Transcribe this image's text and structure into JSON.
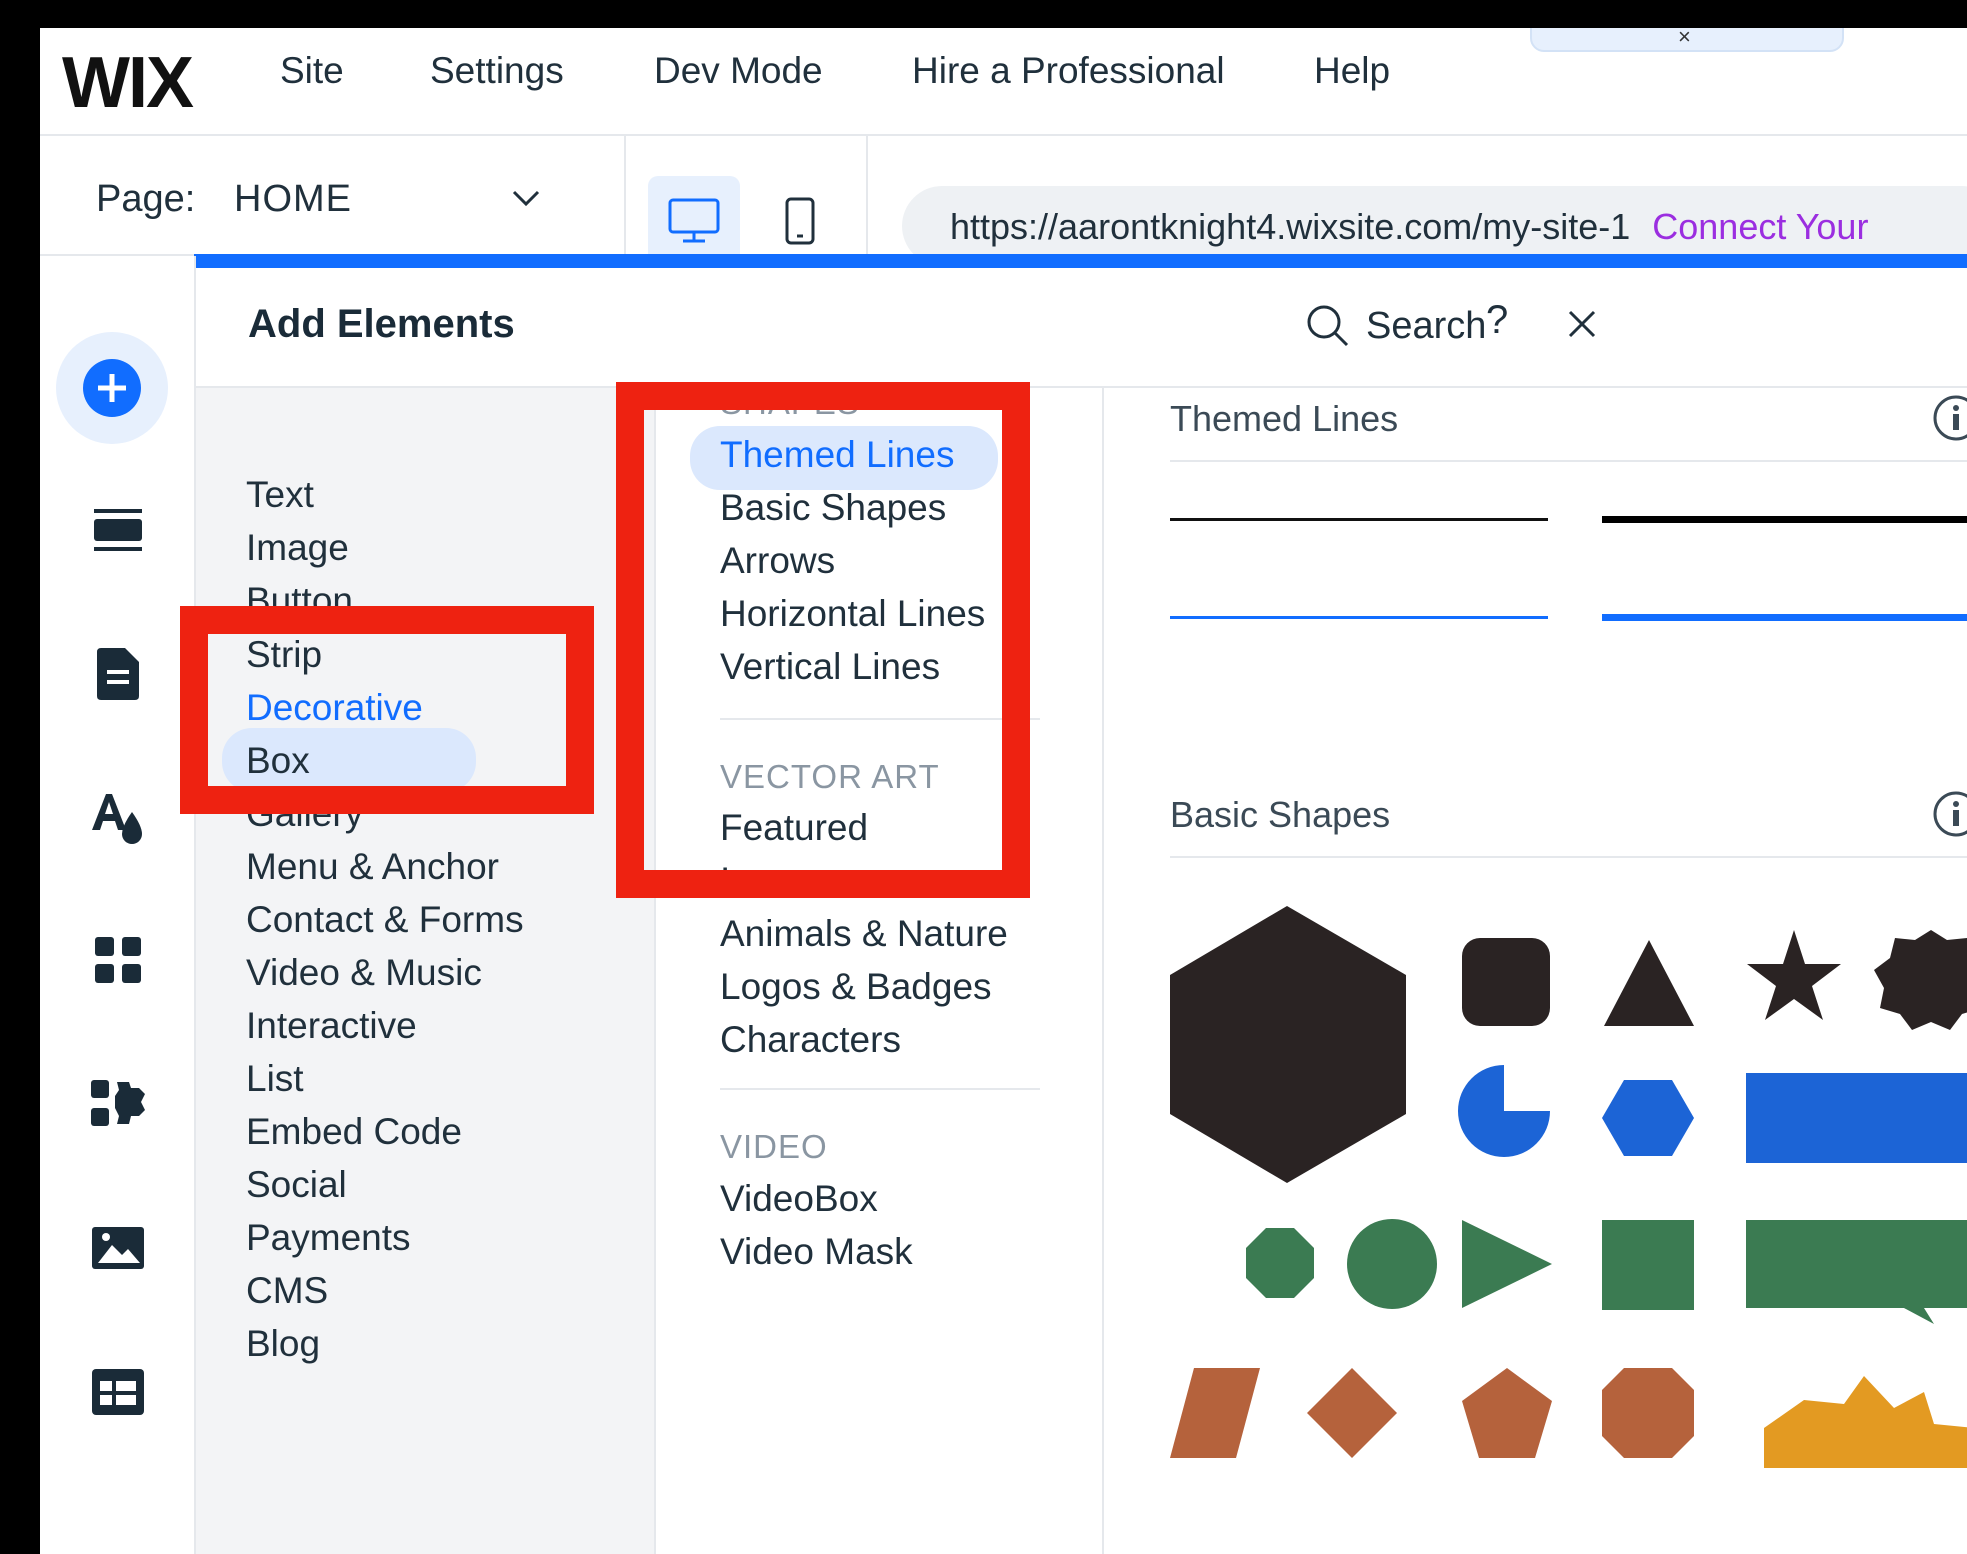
{
  "logo": "WIX",
  "top_menu": [
    "Site",
    "Settings",
    "Dev Mode",
    "Hire a Professional",
    "Help"
  ],
  "collapse_handle_glyph": "×",
  "page_bar": {
    "page_label": "Page:",
    "page_value": "HOME",
    "url": "https://aarontknight4.wixsite.com/my-site-1",
    "connect_text": "Connect Your"
  },
  "panel": {
    "title": "Add Elements",
    "search_label": "Search",
    "help_glyph": "?"
  },
  "categories": [
    "Text",
    "Image",
    "Button",
    "Strip",
    "Decorative",
    "Box",
    "Gallery",
    "Menu & Anchor",
    "Contact & Forms",
    "Video & Music",
    "Interactive",
    "List",
    "Embed Code",
    "Social",
    "Payments",
    "CMS",
    "Blog"
  ],
  "selected_category": "Decorative",
  "subcategories": {
    "shapes_header": "SHAPES",
    "shapes": [
      "Themed Lines",
      "Basic Shapes",
      "Arrows",
      "Horizontal Lines",
      "Vertical Lines"
    ],
    "selected": "Themed Lines",
    "vector_header": "VECTOR ART",
    "vector": [
      "Featured",
      "Icons",
      "Animals & Nature",
      "Logos & Badges",
      "Characters"
    ],
    "video_header": "VIDEO",
    "video": [
      "VideoBox",
      "Video Mask"
    ]
  },
  "content": {
    "themed_lines_title": "Themed Lines",
    "basic_shapes_title": "Basic Shapes"
  },
  "colors": {
    "accent": "#116dff",
    "highlight_box": "#ee2211",
    "shape_dark": "#2a2323",
    "shape_blue": "#1c64d6",
    "shape_green": "#3b7b52",
    "shape_orange": "#b5623c",
    "shape_gold": "#e39a22",
    "connect_purple": "#9b2ee0"
  },
  "icons": [
    "add-icon",
    "sections-icon",
    "pages-icon",
    "theme-icon",
    "apps-icon",
    "business-apps-icon",
    "media-icon",
    "cms-icon",
    "desktop-icon",
    "mobile-icon",
    "chevron-down-icon",
    "search-icon",
    "close-icon",
    "info-icon"
  ]
}
